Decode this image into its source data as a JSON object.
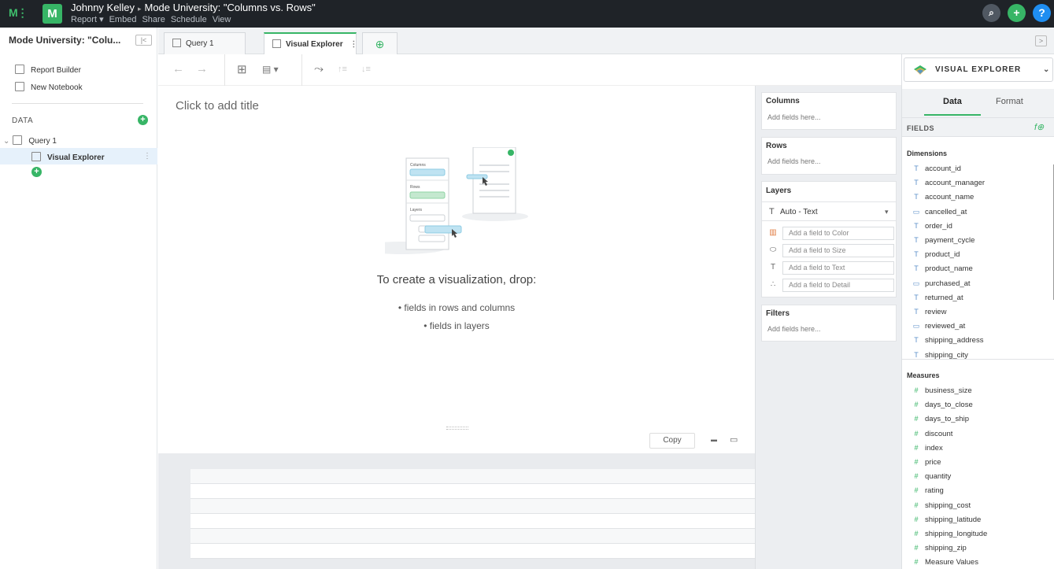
{
  "topbar": {
    "mode_logo": "M⋮",
    "report_logo": "M",
    "author": "Johnny Kelley",
    "crumb_sep": "▸",
    "report_title": "Mode University: \"Columns vs. Rows\"",
    "menu": [
      "Report ▾",
      "Embed",
      "Share",
      "Schedule",
      "View"
    ],
    "search_glyph": "⌕",
    "add_glyph": "+",
    "help_glyph": "?",
    "colors": {
      "bg": "#1f2328",
      "green": "#37b566",
      "blue": "#1f8ef1",
      "gray": "#505862"
    }
  },
  "sidebar": {
    "title": "Mode University: \"Colu...",
    "collapse_glyph": "|<",
    "items": [
      {
        "label": "Report Builder"
      },
      {
        "label": "New Notebook"
      }
    ],
    "data_label": "DATA",
    "query_label": "Query 1",
    "visual_explorer_label": "Visual Explorer",
    "caret": "⌄",
    "more": "⋮"
  },
  "tabs": {
    "query": "Query 1",
    "visual_explorer": "Visual Explorer",
    "more": "⋮",
    "new_chart": "⊕",
    "right_toggle": ">"
  },
  "toolbar": {
    "undo": "←",
    "redo": "→",
    "add_chart": "⊞",
    "chart_type": "▤ ▾",
    "swap_axes": "⤳",
    "sort_asc": "↑≡",
    "sort_desc": "↓≡"
  },
  "canvas": {
    "add_title": "Click to add title",
    "illustration_labels": {
      "columns": "Columns",
      "rows": "Rows",
      "layers": "Layers"
    },
    "drop_title": "To create a visualization, drop:",
    "drop_lines": [
      "• fields in rows and columns",
      "• fields in layers"
    ],
    "copy_label": "Copy",
    "minimize_glyph": "▬",
    "maximize_glyph": "▭"
  },
  "shelves": {
    "columns": {
      "name": "Columns",
      "placeholder": "Add fields here..."
    },
    "rows": {
      "name": "Rows",
      "placeholder": "Add fields here..."
    },
    "layers": {
      "name": "Layers",
      "mark_type": "Auto - Text",
      "mark_glyph": "T",
      "dropdown": "▾",
      "rows": [
        {
          "icon": "▥",
          "label": "Add a field to Color"
        },
        {
          "icon": "⬭",
          "label": "Add a field to Size"
        },
        {
          "icon": "T",
          "label": "Add a field to Text"
        },
        {
          "icon": "∴",
          "label": "Add a field to Detail"
        }
      ]
    },
    "filters": {
      "name": "Filters",
      "placeholder": "Add fields here..."
    }
  },
  "right_panel": {
    "selector_label": "VISUAL EXPLORER",
    "selector_caret": "⌄",
    "tabs": [
      "Data",
      "Format"
    ],
    "fields_label": "FIELDS",
    "fx_glyph": "f⊕",
    "dimensions_label": "Dimensions",
    "dimensions": [
      {
        "name": "account_id",
        "type": "T"
      },
      {
        "name": "account_manager",
        "type": "T"
      },
      {
        "name": "account_name",
        "type": "T"
      },
      {
        "name": "cancelled_at",
        "type": "▭"
      },
      {
        "name": "order_id",
        "type": "T"
      },
      {
        "name": "payment_cycle",
        "type": "T"
      },
      {
        "name": "product_id",
        "type": "T"
      },
      {
        "name": "product_name",
        "type": "T"
      },
      {
        "name": "purchased_at",
        "type": "▭"
      },
      {
        "name": "returned_at",
        "type": "T"
      },
      {
        "name": "review",
        "type": "T"
      },
      {
        "name": "reviewed_at",
        "type": "▭"
      },
      {
        "name": "shipping_address",
        "type": "T"
      },
      {
        "name": "shipping_city",
        "type": "T"
      }
    ],
    "measures_label": "Measures",
    "measures": [
      "business_size",
      "days_to_close",
      "days_to_ship",
      "discount",
      "index",
      "price",
      "quantity",
      "rating",
      "shipping_cost",
      "shipping_latitude",
      "shipping_longitude",
      "shipping_zip",
      "Measure Values"
    ],
    "measure_glyph": "#"
  }
}
